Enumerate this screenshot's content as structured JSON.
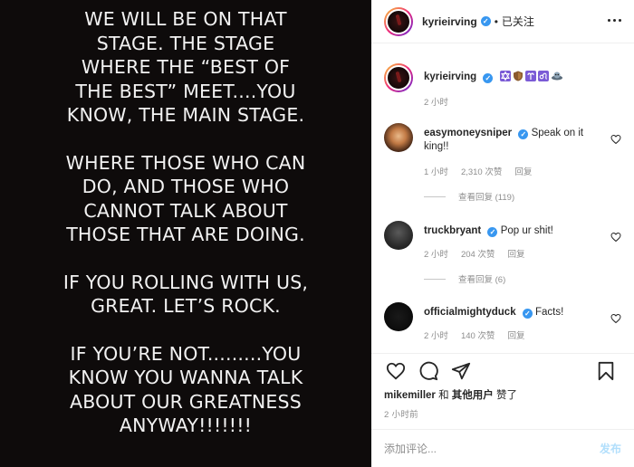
{
  "post_text": [
    [
      "WE WILL BE ON THAT",
      "STAGE. THE STAGE",
      "WHERE THE “BEST OF",
      "THE BEST” MEET....YOU",
      "KNOW, THE MAIN STAGE."
    ],
    [
      "WHERE THOSE WHO CAN",
      "DO, AND THOSE WHO",
      "CANNOT TALK ABOUT",
      "THOSE THAT ARE DOING."
    ],
    [
      "IF YOU ROLLING WITH US,",
      "GREAT. LET’S ROCK."
    ],
    [
      "IF YOU’RE NOT.........YOU",
      "KNOW YOU WANNA TALK",
      "ABOUT OUR GREATNESS",
      "ANYWAY!!!!!!!"
    ]
  ],
  "header": {
    "username": "kyrieirving",
    "separator": "•",
    "follow_status": "已关注"
  },
  "caption": {
    "username": "kyrieirving",
    "emoji_icons": [
      "star-of-david-icon",
      "shield-icon",
      "aries-icon",
      "leo-icon",
      "alien-icon"
    ],
    "time": "2 小时"
  },
  "comments": [
    {
      "username": "easymoneysniper",
      "text": "Speak on it king!!",
      "time": "1 小时",
      "likes": "2,310 次赞",
      "reply_label": "回复",
      "view_replies": "查看回复 (119)"
    },
    {
      "username": "truckbryant",
      "text": "Pop ur shit!",
      "time": "2 小时",
      "likes": "204 次赞",
      "reply_label": "回复",
      "view_replies": "查看回复 (6)"
    },
    {
      "username": "officialmightyduck",
      "text": "Facts!",
      "time": "2 小时",
      "likes": "140 次赞",
      "reply_label": "回复"
    }
  ],
  "likes": {
    "user": "mikemiller",
    "connector": " 和 ",
    "others": "其他用户",
    "suffix": " 赞了"
  },
  "post_time": "2 小时前",
  "add_comment": {
    "placeholder": "添加评论...",
    "post_label": "发布"
  },
  "colors": {
    "verified": "#3897f0",
    "image_bg": "#0e0b0b",
    "post_button_disabled": "#b2dffc"
  }
}
